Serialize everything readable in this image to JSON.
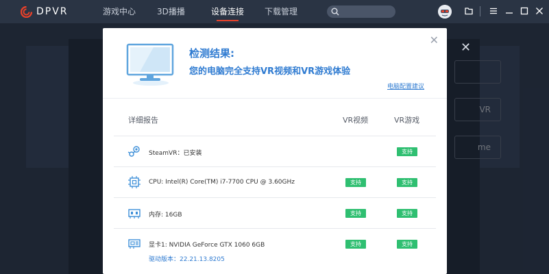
{
  "app": {
    "logo_text": "DPVR",
    "brand_color": "#e8412a"
  },
  "nav": {
    "items": [
      {
        "label": "游戏中心",
        "active": false
      },
      {
        "label": "3D播播",
        "active": false
      },
      {
        "label": "设备连接",
        "active": true
      },
      {
        "label": "下载管理",
        "active": false
      }
    ]
  },
  "background": {
    "buttons": [
      "",
      "VR",
      "me"
    ]
  },
  "dialog": {
    "title": "检测结果:",
    "description": "您的电脑完全支持VR视频和VR游戏体验",
    "config_link": "电脑配置建议",
    "headers": {
      "report": "详细报告",
      "vr_video": "VR视频",
      "vr_game": "VR游戏"
    },
    "rows": [
      {
        "icon": "steam-icon",
        "text": "SteamVR：已安装",
        "sub": "",
        "vr_video": "",
        "vr_game": "支持"
      },
      {
        "icon": "cpu-icon",
        "text": "CPU: Intel(R) Core(TM) i7-7700 CPU @ 3.60GHz",
        "sub": "",
        "vr_video": "支持",
        "vr_game": "支持"
      },
      {
        "icon": "memory-icon",
        "text": "内存: 16GB",
        "sub": "",
        "vr_video": "支持",
        "vr_game": "支持"
      },
      {
        "icon": "gpu-icon",
        "text": "显卡1: NVIDIA GeForce GTX 1060 6GB",
        "sub": "驱动版本：22.21.13.8205",
        "vr_video": "支持",
        "vr_game": "支持"
      }
    ],
    "badge_color": "#2fbf71",
    "accent_color": "#2f7bd1"
  }
}
